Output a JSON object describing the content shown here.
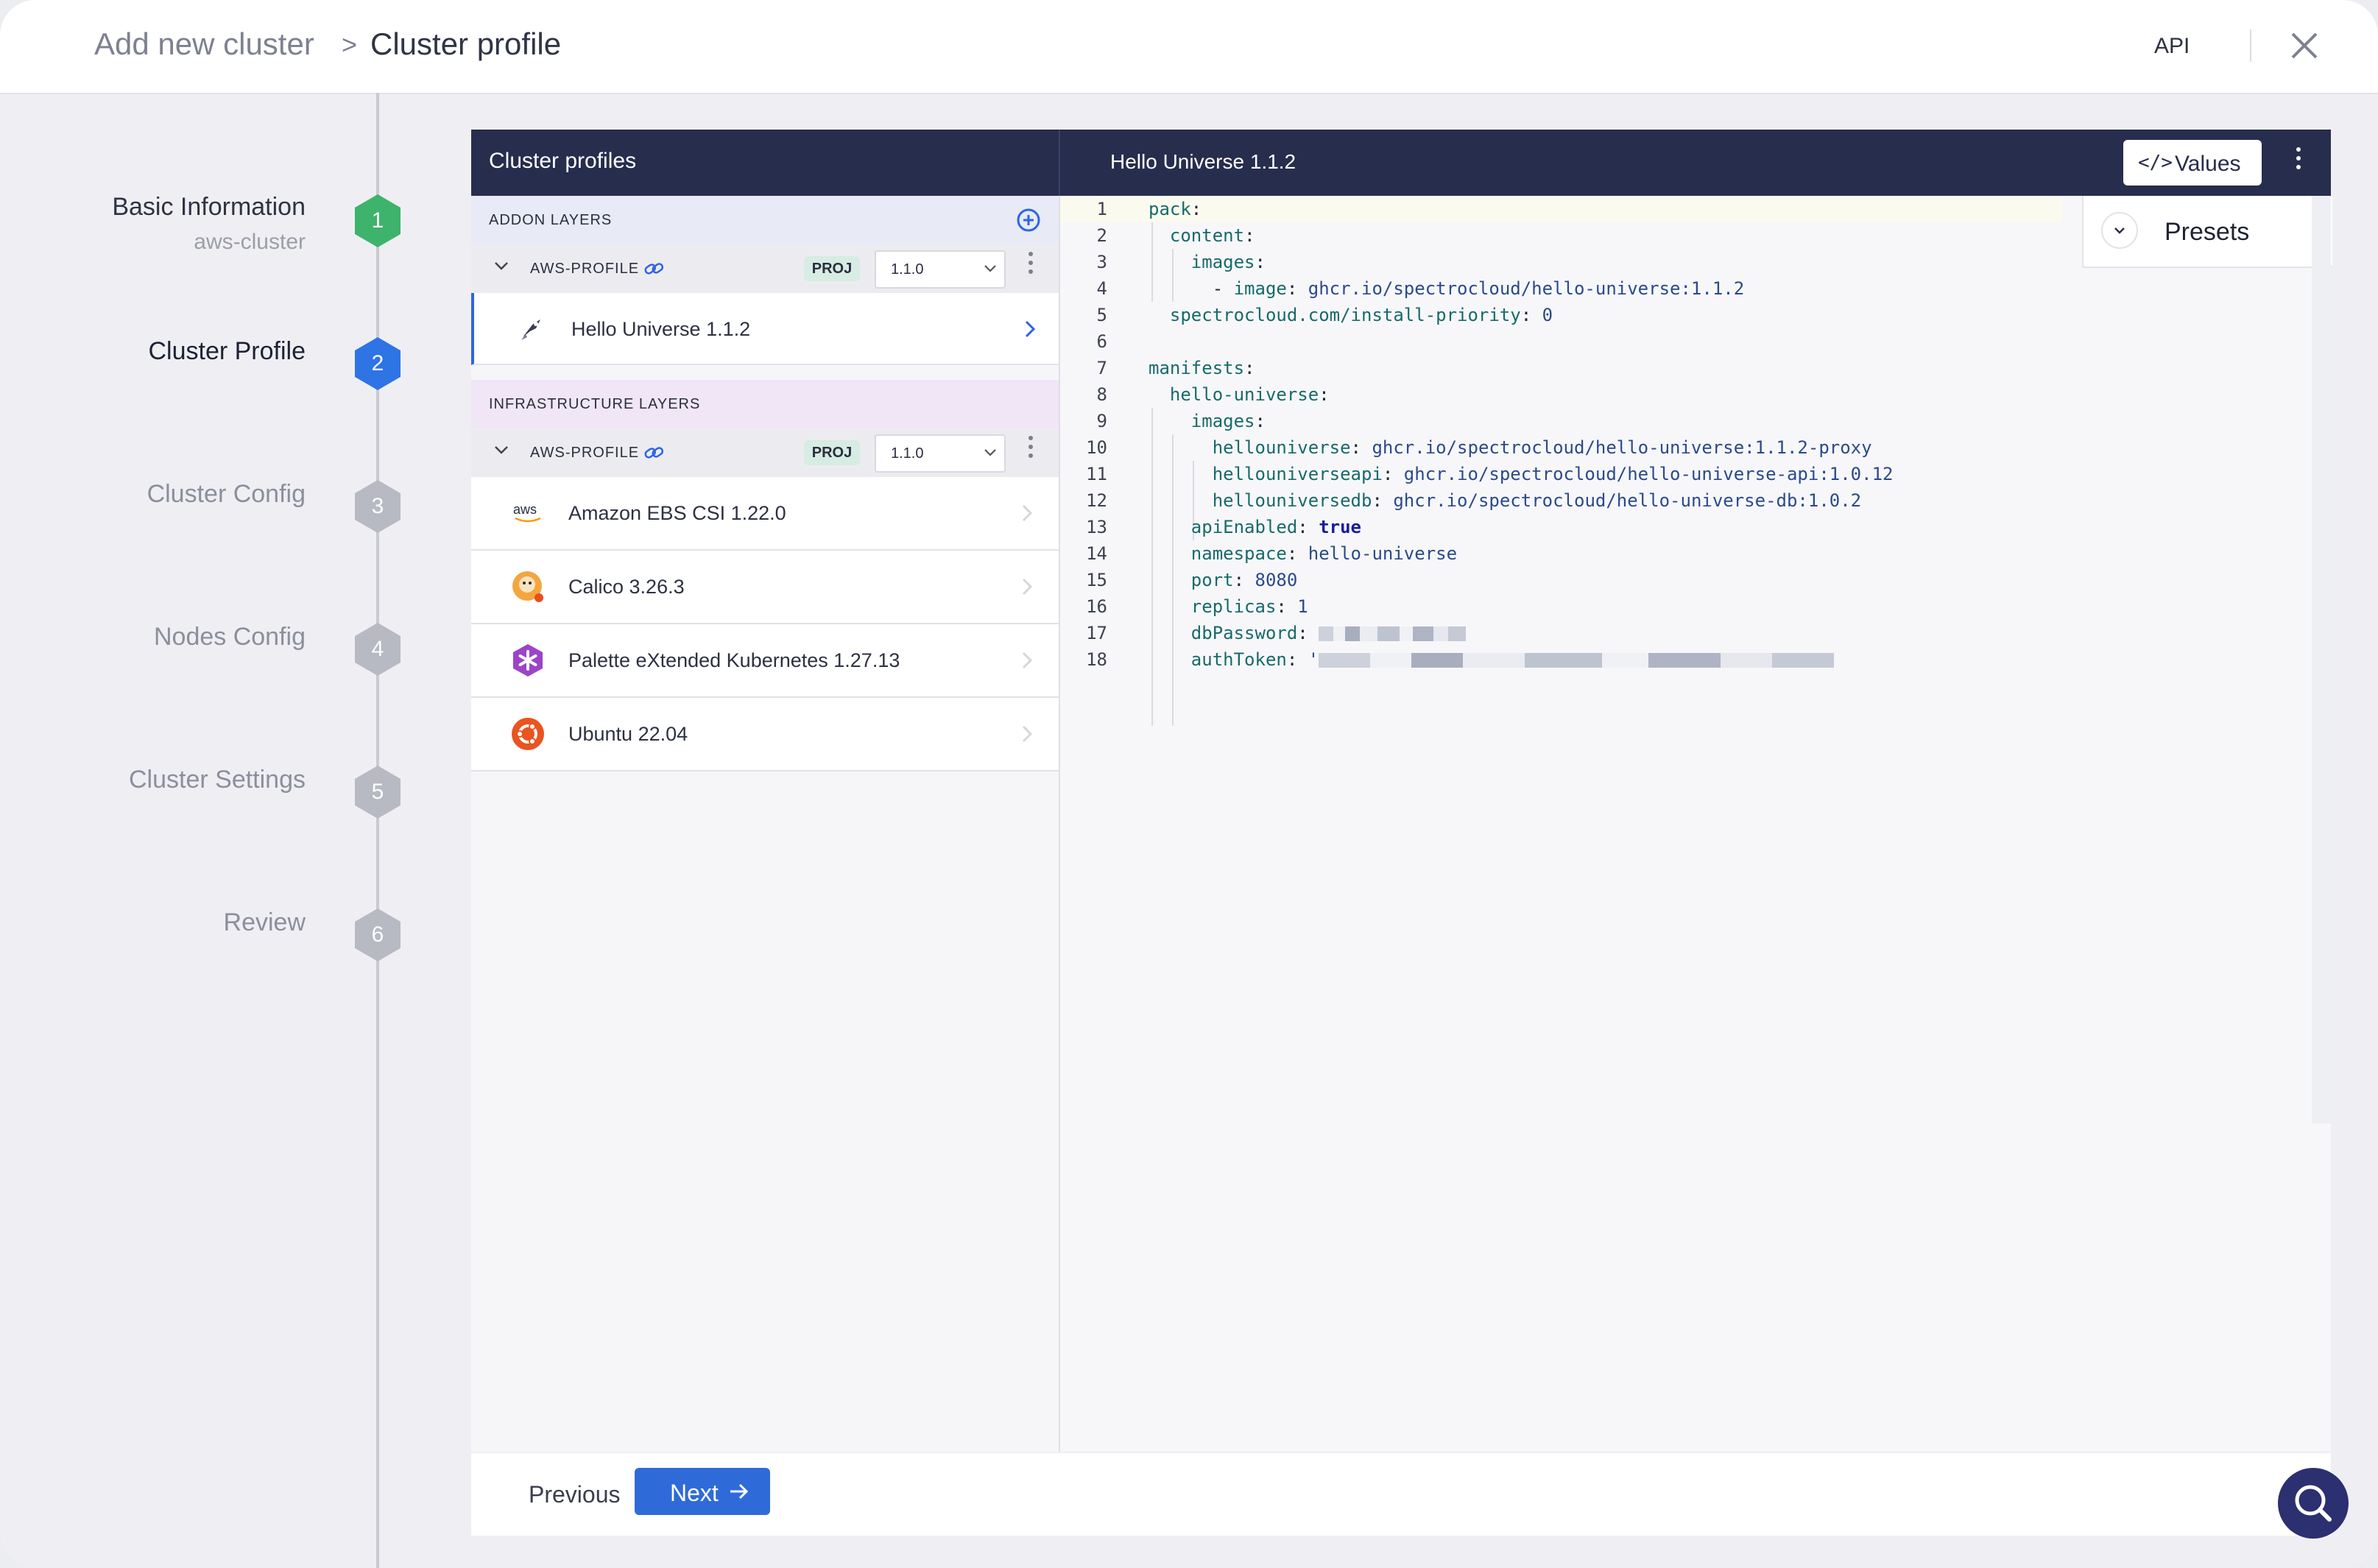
{
  "header": {
    "breadcrumb_root": "Add new cluster",
    "breadcrumb_separator": ">",
    "breadcrumb_current": "Cluster profile",
    "api_label": "API"
  },
  "steps": [
    {
      "number": "1",
      "title": "Basic Information",
      "subtitle": "aws-cluster",
      "state": "done",
      "color": "#3db36b"
    },
    {
      "number": "2",
      "title": "Cluster Profile",
      "state": "active",
      "color": "#2e74e5"
    },
    {
      "number": "3",
      "title": "Cluster Config",
      "state": "pending",
      "color": "#b8bac3"
    },
    {
      "number": "4",
      "title": "Nodes Config",
      "state": "pending",
      "color": "#b8bac3"
    },
    {
      "number": "5",
      "title": "Cluster Settings",
      "state": "pending",
      "color": "#b8bac3"
    },
    {
      "number": "6",
      "title": "Review",
      "state": "pending",
      "color": "#b8bac3"
    }
  ],
  "left_panel": {
    "title": "Cluster profiles",
    "addon_section": {
      "label": "ADDON LAYERS",
      "profile": {
        "name": "AWS-PROFILE",
        "badge": "PROJ",
        "version": "1.1.0"
      },
      "layers": [
        {
          "name": "Hello Universe 1.1.2",
          "icon": "hello-universe-icon",
          "selected": true
        }
      ]
    },
    "infra_section": {
      "label": "INFRASTRUCTURE LAYERS",
      "profile": {
        "name": "AWS-PROFILE",
        "badge": "PROJ",
        "version": "1.1.0"
      },
      "layers": [
        {
          "name": "Amazon EBS CSI 1.22.0",
          "icon": "aws-logo-icon"
        },
        {
          "name": "Calico 3.26.3",
          "icon": "calico-logo-icon"
        },
        {
          "name": "Palette eXtended Kubernetes 1.27.13",
          "icon": "kubernetes-logo-icon"
        },
        {
          "name": "Ubuntu 22.04",
          "icon": "ubuntu-logo-icon"
        }
      ]
    }
  },
  "editor": {
    "title": "Hello Universe 1.1.2",
    "values_button": "Values",
    "presets_label": "Presets",
    "lines": [
      {
        "n": "1"
      },
      {
        "n": "2"
      },
      {
        "n": "3"
      },
      {
        "n": "4"
      },
      {
        "n": "5"
      },
      {
        "n": "6"
      },
      {
        "n": "7"
      },
      {
        "n": "8"
      },
      {
        "n": "9"
      },
      {
        "n": "10"
      },
      {
        "n": "11"
      },
      {
        "n": "12"
      },
      {
        "n": "13"
      },
      {
        "n": "14"
      },
      {
        "n": "15"
      },
      {
        "n": "16"
      },
      {
        "n": "17"
      },
      {
        "n": "18"
      }
    ],
    "code": {
      "l1_key": "pack",
      "l2_key": "content",
      "l3_key": "images",
      "l4_key": "image",
      "l4_val": "ghcr.io/spectrocloud/hello-universe:1.1.2",
      "l5_key": "spectrocloud.com/install-priority",
      "l5_val": "0",
      "l7_key": "manifests",
      "l8_key": "hello-universe",
      "l9_key": "images",
      "l10_key": "hellouniverse",
      "l10_val": "ghcr.io/spectrocloud/hello-universe:1.1.2-proxy",
      "l11_key": "hellouniverseapi",
      "l11_val": "ghcr.io/spectrocloud/hello-universe-api:1.0.12",
      "l12_key": "hellouniversedb",
      "l12_val": "ghcr.io/spectrocloud/hello-universe-db:1.0.2",
      "l13_key": "apiEnabled",
      "l13_val": "true",
      "l14_key": "namespace",
      "l14_val": "hello-universe",
      "l15_key": "port",
      "l15_val": "8080",
      "l16_key": "replicas",
      "l16_val": "1",
      "l17_key": "dbPassword",
      "l18_key": "authToken",
      "l18_quote": "'"
    }
  },
  "footer": {
    "previous_label": "Previous",
    "next_label": "Next"
  }
}
